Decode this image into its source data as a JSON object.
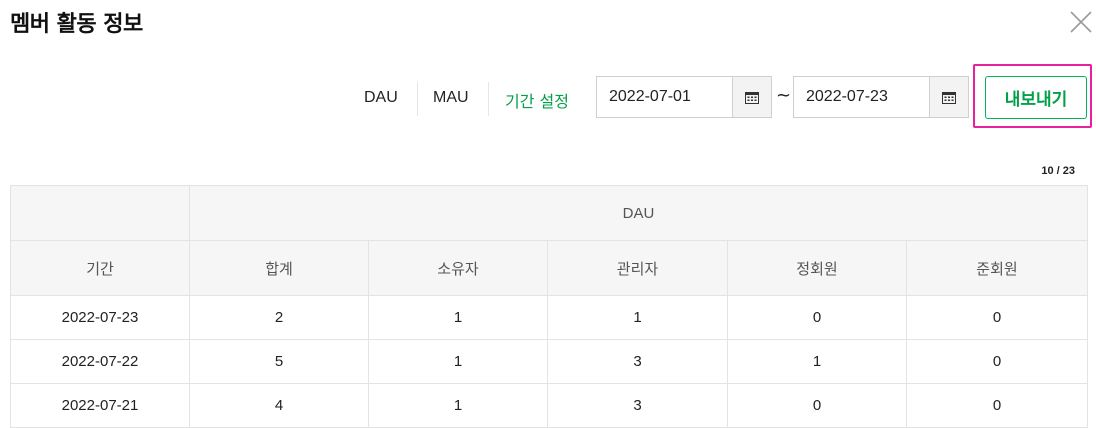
{
  "header": {
    "title": "멤버 활동 정보",
    "close_icon": "close-icon"
  },
  "toolbar": {
    "tabs": [
      {
        "label": "DAU"
      },
      {
        "label": "MAU"
      }
    ],
    "period_label": "기간 설정",
    "start_date": "2022-07-01",
    "end_date": "2022-07-23",
    "range_separator": "~",
    "calendar_icon": "calendar-icon",
    "export_label": "내보내기",
    "accent_color": "#03a04a",
    "highlight_color": "#e6219c"
  },
  "table": {
    "count": "10 / 23",
    "group_header": "DAU",
    "columns": [
      "기간",
      "합계",
      "소유자",
      "관리자",
      "정회원",
      "준회원"
    ],
    "rows": [
      [
        "2022-07-23",
        "2",
        "1",
        "1",
        "0",
        "0"
      ],
      [
        "2022-07-22",
        "5",
        "1",
        "3",
        "1",
        "0"
      ],
      [
        "2022-07-21",
        "4",
        "1",
        "3",
        "0",
        "0"
      ]
    ]
  }
}
